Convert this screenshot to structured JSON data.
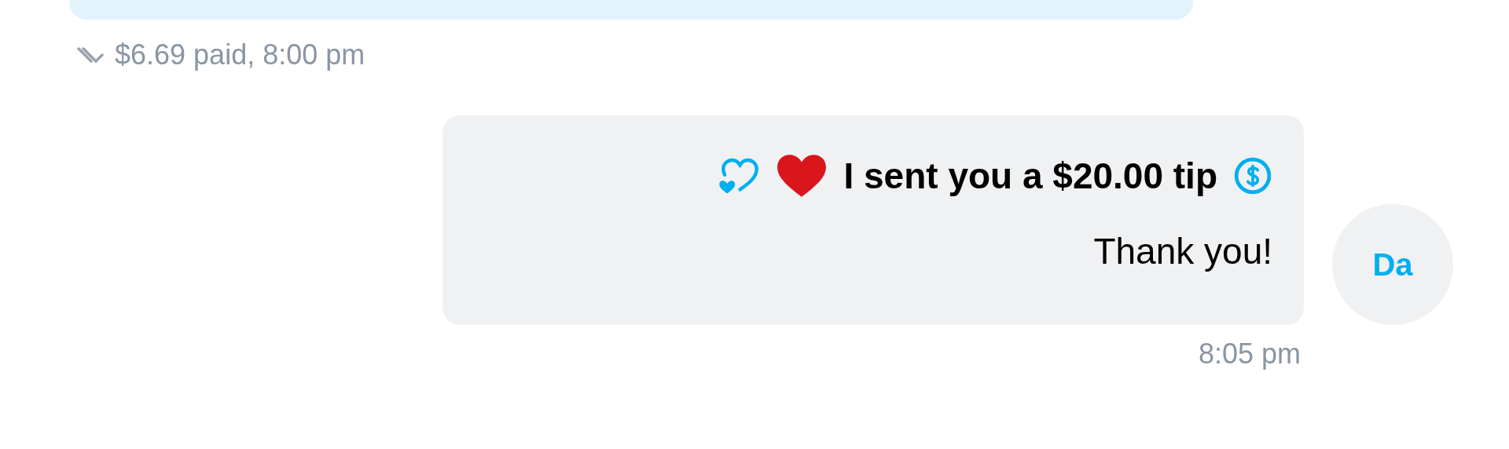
{
  "messages": [
    {
      "kind": "paid",
      "status": "$6.69 paid, 8:00 pm",
      "read": true
    },
    {
      "kind": "tip",
      "avatar": "Da",
      "tip_text": "I sent you a $20.00 tip",
      "text": "Thank you!",
      "time": "8:05 pm"
    }
  ]
}
